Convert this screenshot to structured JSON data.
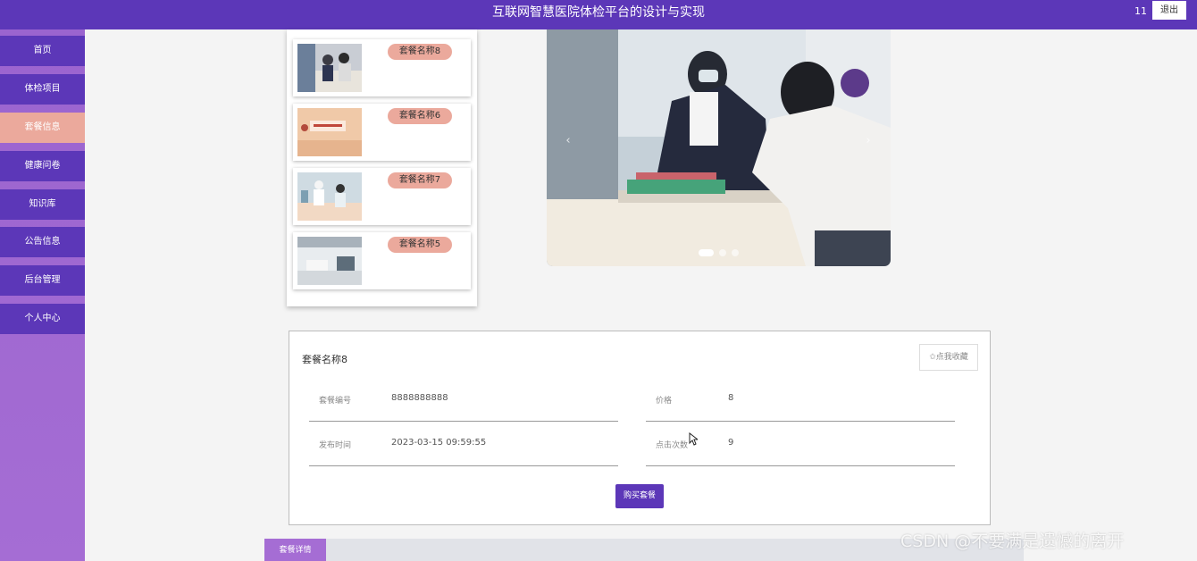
{
  "header": {
    "title": "互联网智慧医院体检平台的设计与实现",
    "user_name": "11",
    "logout_label": "退出"
  },
  "sidebar": {
    "items": [
      {
        "label": "首页",
        "active": false
      },
      {
        "label": "体检项目",
        "active": false
      },
      {
        "label": "套餐信息",
        "active": true
      },
      {
        "label": "健康问卷",
        "active": false
      },
      {
        "label": "知识库",
        "active": false
      },
      {
        "label": "公告信息",
        "active": false
      },
      {
        "label": "后台管理",
        "active": false
      },
      {
        "label": "个人中心",
        "active": false
      }
    ]
  },
  "package_list": [
    {
      "name": "套餐名称8"
    },
    {
      "name": "套餐名称6"
    },
    {
      "name": "套餐名称7"
    },
    {
      "name": "套餐名称5"
    }
  ],
  "carousel": {
    "prev_icon": "‹",
    "next_icon": "›",
    "slide_count": 3,
    "active_slide": 1
  },
  "detail": {
    "title": "套餐名称8",
    "favorite_label": "✩点我收藏",
    "fields": [
      {
        "label": "套餐编号",
        "value": "8888888888"
      },
      {
        "label": "价格",
        "value": "8"
      },
      {
        "label": "发布时间",
        "value": "2023-03-15 09:59:55"
      },
      {
        "label": "点击次数",
        "value": "9"
      }
    ],
    "buy_label": "购买套餐"
  },
  "tabs": {
    "detail_tab": "套餐详情"
  },
  "watermark": "CSDN @不要满是遗憾的离开",
  "colors": {
    "primary": "#5c37b8",
    "accent": "#eba99c",
    "sidebar_bg": "#a56dd4"
  }
}
